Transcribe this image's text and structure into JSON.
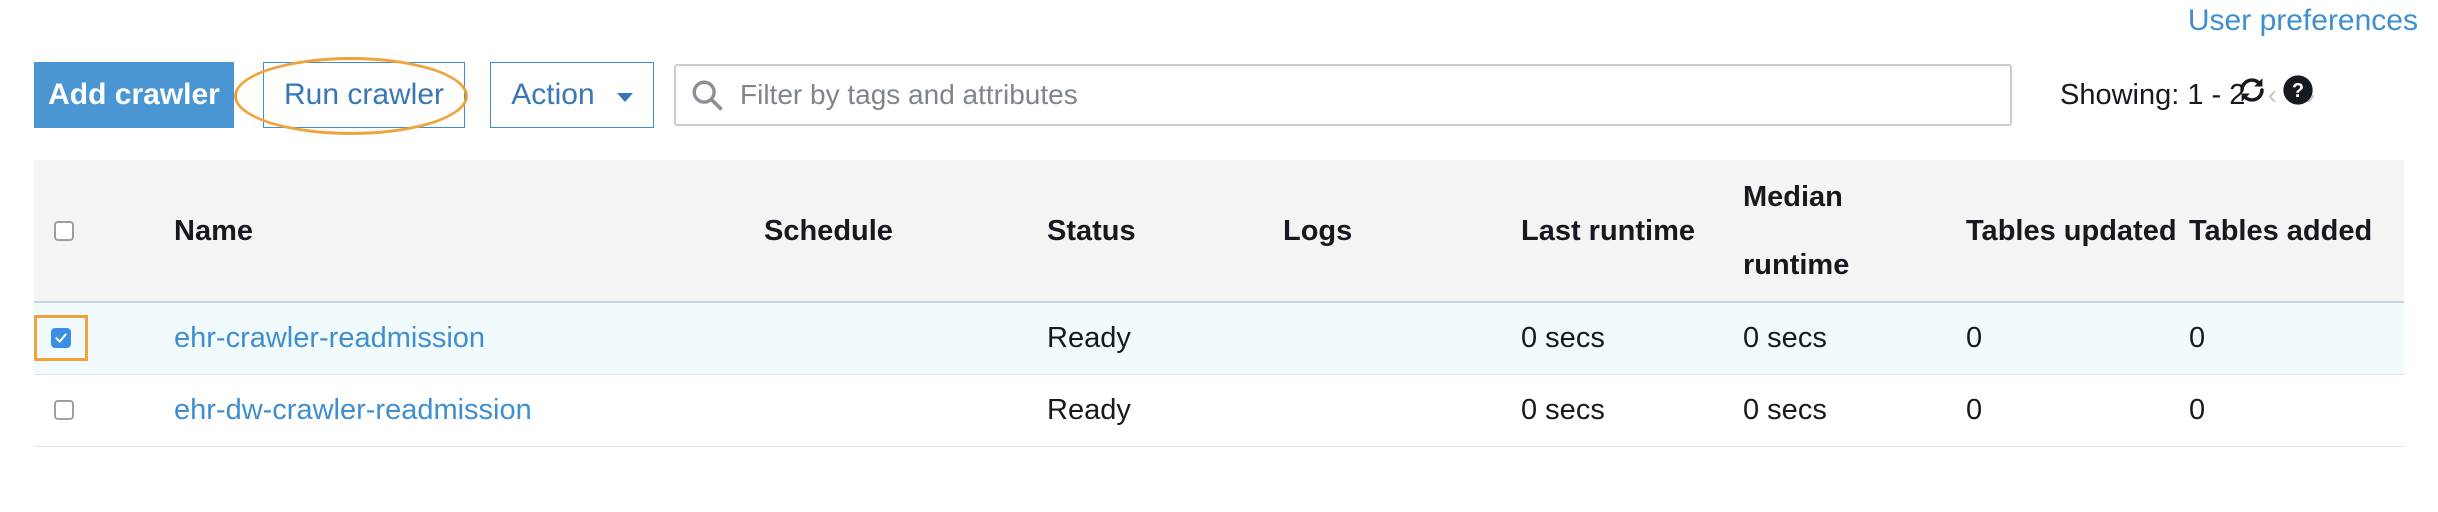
{
  "header": {
    "user_preferences": "User preferences"
  },
  "toolbar": {
    "add_label": "Add crawler",
    "run_label": "Run crawler",
    "action_label": "Action",
    "search_placeholder": "Filter by tags and attributes",
    "showing": "Showing: 1 - 2",
    "prev_icon": "chevron-left-icon",
    "next_icon": "chevron-right-icon",
    "refresh_icon": "refresh-icon",
    "help_icon": "help-icon"
  },
  "table": {
    "columns": {
      "name": "Name",
      "schedule": "Schedule",
      "status": "Status",
      "logs": "Logs",
      "last_runtime": "Last runtime",
      "median_runtime_1": "Median",
      "median_runtime_2": "runtime",
      "tables_updated": "Tables updated",
      "tables_added": "Tables added"
    },
    "rows": [
      {
        "selected": true,
        "name": "ehr-crawler-readmission",
        "schedule": "",
        "status": "Ready",
        "logs": "",
        "last_runtime": "0 secs",
        "median_runtime": "0 secs",
        "tables_updated": "0",
        "tables_added": "0"
      },
      {
        "selected": false,
        "name": "ehr-dw-crawler-readmission",
        "schedule": "",
        "status": "Ready",
        "logs": "",
        "last_runtime": "0 secs",
        "median_runtime": "0 secs",
        "tables_updated": "0",
        "tables_added": "0"
      }
    ]
  },
  "colors": {
    "primary": "#4a96d2",
    "link": "#3f8fd0",
    "highlight": "#f0a33c",
    "selected_row": "#f1fbfd"
  }
}
